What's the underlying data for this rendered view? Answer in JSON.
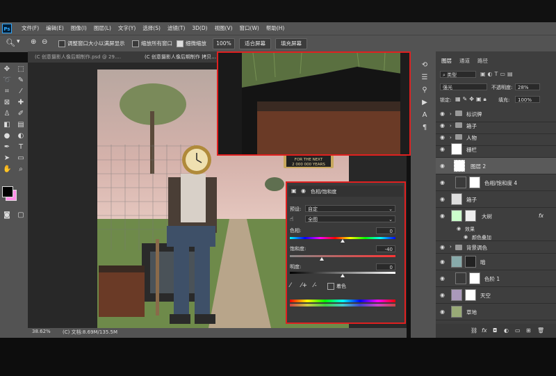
{
  "app": {
    "logo": "Ps"
  },
  "menu": [
    "文件(F)",
    "编辑(E)",
    "图像(I)",
    "图层(L)",
    "文字(Y)",
    "选择(S)",
    "滤镜(T)",
    "3D(D)",
    "视图(V)",
    "窗口(W)",
    "帮助(H)"
  ],
  "options": {
    "resize_windows": "调整窗口大小以满屏显示",
    "zoom_all": "缩放所有窗口",
    "scrubby_zoom": "细微缩放",
    "zoom_value": "100%",
    "fit_screen": "适合屏幕",
    "fill_screen": "填充屏幕"
  },
  "tabs": [
    "(C 创意摄影人像后期制作.psd @ 29.…",
    "(C 创意摄影人像后期制作 拷贝…"
  ],
  "status": {
    "zoom": "38.62%",
    "doc": "(C) 文档:8.69M/135.5M"
  },
  "photo_sign": {
    "line1": "FOR THE NEXT",
    "line2": "2 000 000 YEARS"
  },
  "properties": {
    "title": "色相/饱和度",
    "preset_label": "预设:",
    "preset_value": "自定",
    "channel_value": "全图",
    "hue_label": "色相:",
    "hue_value": "0",
    "saturation_label": "饱和度:",
    "saturation_value": "-40",
    "lightness_label": "明度:",
    "lightness_value": "0",
    "colorize_label": "着色",
    "hue_level": 0.5,
    "saturation_level": 0.3,
    "lightness_level": 0.5
  },
  "layers_panel": {
    "tabs": [
      "图层",
      "通道",
      "路径"
    ],
    "kind_label": "类型",
    "blend_mode": "强光",
    "opacity_label": "不透明度:",
    "opacity_value": "28%",
    "lock_label": "锁定:",
    "fill_label": "填充:",
    "fill_value": "100%",
    "layers": [
      {
        "name": "标识牌",
        "kind": "folder"
      },
      {
        "name": "箱子",
        "kind": "folder"
      },
      {
        "name": "人物",
        "kind": "folder"
      },
      {
        "name": "栅栏",
        "kind": "layer"
      },
      {
        "name": "图层 2",
        "kind": "layer"
      },
      {
        "name": "色相/饱和度 4",
        "kind": "adjust"
      },
      {
        "name": "箱子",
        "kind": "layer"
      },
      {
        "name": "大树",
        "kind": "layer",
        "fx": "fx"
      },
      {
        "name": "效果",
        "kind": "effect"
      },
      {
        "name": "颜色叠加",
        "kind": "effect"
      },
      {
        "name": "背景调色",
        "kind": "folder"
      },
      {
        "name": "暗",
        "kind": "layer"
      },
      {
        "name": "色阶 1",
        "kind": "adjust"
      },
      {
        "name": "天空",
        "kind": "layer"
      },
      {
        "name": "草地",
        "kind": "layer"
      }
    ]
  },
  "colors": {
    "foreground": "#000000",
    "background": "#ff8fe6",
    "highlight": "#e02020"
  }
}
